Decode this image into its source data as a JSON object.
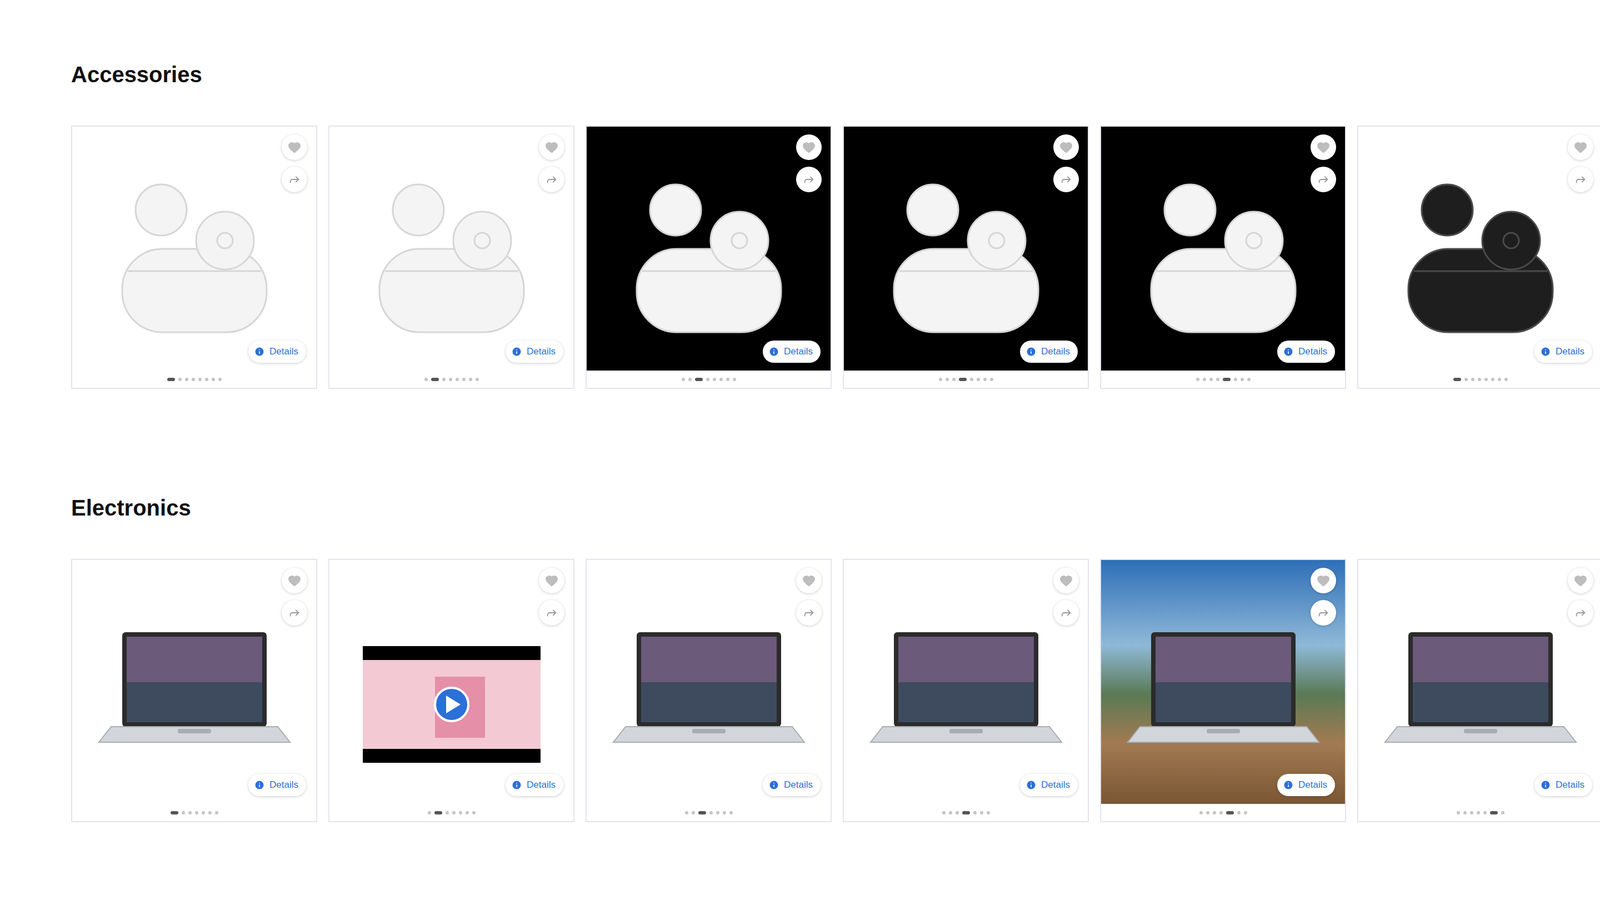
{
  "sections": [
    {
      "title": "Accessories",
      "products": [
        {
          "image": {
            "kind": "earbuds",
            "ground": "light",
            "finish": "white"
          },
          "favorite": false,
          "details": "Details",
          "dots": [
            {
              "selected": true
            },
            {
              "selected": false
            },
            {
              "selected": false
            },
            {
              "selected": false
            },
            {
              "selected": false
            },
            {
              "selected": false
            },
            {
              "selected": false
            },
            {
              "selected": false
            }
          ]
        },
        {
          "image": {
            "kind": "earbuds",
            "ground": "light",
            "finish": "white"
          },
          "favorite": false,
          "details": "Details",
          "dots": [
            {
              "selected": false
            },
            {
              "selected": true
            },
            {
              "selected": false
            },
            {
              "selected": false
            },
            {
              "selected": false
            },
            {
              "selected": false
            },
            {
              "selected": false
            },
            {
              "selected": false
            }
          ]
        },
        {
          "image": {
            "kind": "earbuds",
            "ground": "dark",
            "finish": "white"
          },
          "favorite": false,
          "details": "Details",
          "dots": [
            {
              "selected": false
            },
            {
              "selected": false
            },
            {
              "selected": true
            },
            {
              "selected": false
            },
            {
              "selected": false
            },
            {
              "selected": false
            },
            {
              "selected": false
            },
            {
              "selected": false
            }
          ]
        },
        {
          "image": {
            "kind": "earbuds",
            "ground": "dark",
            "finish": "white"
          },
          "favorite": false,
          "details": "Details",
          "dots": [
            {
              "selected": false
            },
            {
              "selected": false
            },
            {
              "selected": false
            },
            {
              "selected": true
            },
            {
              "selected": false
            },
            {
              "selected": false
            },
            {
              "selected": false
            },
            {
              "selected": false
            }
          ]
        },
        {
          "image": {
            "kind": "earbuds",
            "ground": "dark",
            "finish": "white"
          },
          "favorite": false,
          "details": "Details",
          "dots": [
            {
              "selected": false
            },
            {
              "selected": false
            },
            {
              "selected": false
            },
            {
              "selected": false
            },
            {
              "selected": true
            },
            {
              "selected": false
            },
            {
              "selected": false
            },
            {
              "selected": false
            }
          ]
        },
        {
          "image": {
            "kind": "earbuds",
            "ground": "light",
            "finish": "black"
          },
          "favorite": false,
          "details": "Details",
          "dots": [
            {
              "selected": true
            },
            {
              "selected": false
            },
            {
              "selected": false
            },
            {
              "selected": false
            },
            {
              "selected": false
            },
            {
              "selected": false
            },
            {
              "selected": false
            },
            {
              "selected": false
            }
          ]
        }
      ]
    },
    {
      "title": "Electronics",
      "products": [
        {
          "image": {
            "kind": "laptop",
            "ground": "light",
            "finish": "silver"
          },
          "favorite": false,
          "details": "Details",
          "dots": [
            {
              "selected": true
            },
            {
              "selected": false
            },
            {
              "selected": false
            },
            {
              "selected": false
            },
            {
              "selected": false
            },
            {
              "selected": false
            },
            {
              "selected": false
            }
          ]
        },
        {
          "image": {
            "kind": "video",
            "ground": "light",
            "finish": "silver"
          },
          "favorite": false,
          "details": "Details",
          "dots": [
            {
              "selected": false
            },
            {
              "selected": true
            },
            {
              "selected": false
            },
            {
              "selected": false
            },
            {
              "selected": false
            },
            {
              "selected": false
            },
            {
              "selected": false
            }
          ]
        },
        {
          "image": {
            "kind": "laptop",
            "ground": "light",
            "finish": "silver"
          },
          "favorite": false,
          "details": "Details",
          "dots": [
            {
              "selected": false
            },
            {
              "selected": false
            },
            {
              "selected": true
            },
            {
              "selected": false
            },
            {
              "selected": false
            },
            {
              "selected": false
            },
            {
              "selected": false
            }
          ]
        },
        {
          "image": {
            "kind": "laptop",
            "ground": "light",
            "finish": "silver"
          },
          "favorite": false,
          "details": "Details",
          "dots": [
            {
              "selected": false
            },
            {
              "selected": false
            },
            {
              "selected": false
            },
            {
              "selected": true
            },
            {
              "selected": false
            },
            {
              "selected": false
            },
            {
              "selected": false
            }
          ]
        },
        {
          "image": {
            "kind": "laptop",
            "ground": "scenic",
            "finish": "silver"
          },
          "favorite": false,
          "details": "Details",
          "dots": [
            {
              "selected": false
            },
            {
              "selected": false
            },
            {
              "selected": false
            },
            {
              "selected": false
            },
            {
              "selected": true
            },
            {
              "selected": false
            },
            {
              "selected": false
            }
          ]
        },
        {
          "image": {
            "kind": "laptop",
            "ground": "light",
            "finish": "silver"
          },
          "favorite": false,
          "details": "Details",
          "dots": [
            {
              "selected": false
            },
            {
              "selected": false
            },
            {
              "selected": false
            },
            {
              "selected": false
            },
            {
              "selected": false
            },
            {
              "selected": true
            },
            {
              "selected": false
            }
          ]
        }
      ]
    }
  ]
}
